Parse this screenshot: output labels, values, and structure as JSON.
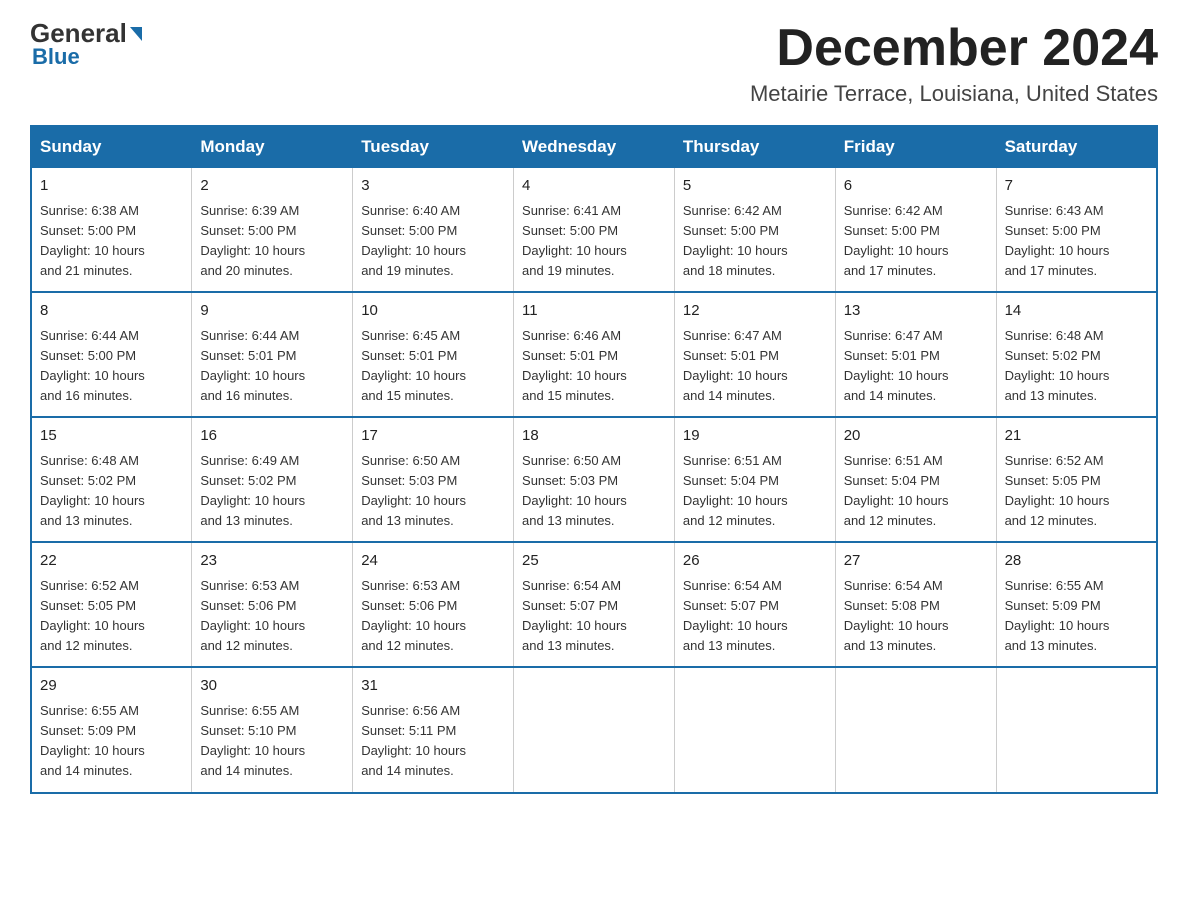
{
  "logo": {
    "general": "General",
    "blue": "Blue"
  },
  "header": {
    "month_title": "December 2024",
    "location": "Metairie Terrace, Louisiana, United States"
  },
  "weekdays": [
    "Sunday",
    "Monday",
    "Tuesday",
    "Wednesday",
    "Thursday",
    "Friday",
    "Saturday"
  ],
  "weeks": [
    [
      {
        "day": "1",
        "sunrise": "6:38 AM",
        "sunset": "5:00 PM",
        "daylight": "10 hours and 21 minutes."
      },
      {
        "day": "2",
        "sunrise": "6:39 AM",
        "sunset": "5:00 PM",
        "daylight": "10 hours and 20 minutes."
      },
      {
        "day": "3",
        "sunrise": "6:40 AM",
        "sunset": "5:00 PM",
        "daylight": "10 hours and 19 minutes."
      },
      {
        "day": "4",
        "sunrise": "6:41 AM",
        "sunset": "5:00 PM",
        "daylight": "10 hours and 19 minutes."
      },
      {
        "day": "5",
        "sunrise": "6:42 AM",
        "sunset": "5:00 PM",
        "daylight": "10 hours and 18 minutes."
      },
      {
        "day": "6",
        "sunrise": "6:42 AM",
        "sunset": "5:00 PM",
        "daylight": "10 hours and 17 minutes."
      },
      {
        "day": "7",
        "sunrise": "6:43 AM",
        "sunset": "5:00 PM",
        "daylight": "10 hours and 17 minutes."
      }
    ],
    [
      {
        "day": "8",
        "sunrise": "6:44 AM",
        "sunset": "5:00 PM",
        "daylight": "10 hours and 16 minutes."
      },
      {
        "day": "9",
        "sunrise": "6:44 AM",
        "sunset": "5:01 PM",
        "daylight": "10 hours and 16 minutes."
      },
      {
        "day": "10",
        "sunrise": "6:45 AM",
        "sunset": "5:01 PM",
        "daylight": "10 hours and 15 minutes."
      },
      {
        "day": "11",
        "sunrise": "6:46 AM",
        "sunset": "5:01 PM",
        "daylight": "10 hours and 15 minutes."
      },
      {
        "day": "12",
        "sunrise": "6:47 AM",
        "sunset": "5:01 PM",
        "daylight": "10 hours and 14 minutes."
      },
      {
        "day": "13",
        "sunrise": "6:47 AM",
        "sunset": "5:01 PM",
        "daylight": "10 hours and 14 minutes."
      },
      {
        "day": "14",
        "sunrise": "6:48 AM",
        "sunset": "5:02 PM",
        "daylight": "10 hours and 13 minutes."
      }
    ],
    [
      {
        "day": "15",
        "sunrise": "6:48 AM",
        "sunset": "5:02 PM",
        "daylight": "10 hours and 13 minutes."
      },
      {
        "day": "16",
        "sunrise": "6:49 AM",
        "sunset": "5:02 PM",
        "daylight": "10 hours and 13 minutes."
      },
      {
        "day": "17",
        "sunrise": "6:50 AM",
        "sunset": "5:03 PM",
        "daylight": "10 hours and 13 minutes."
      },
      {
        "day": "18",
        "sunrise": "6:50 AM",
        "sunset": "5:03 PM",
        "daylight": "10 hours and 13 minutes."
      },
      {
        "day": "19",
        "sunrise": "6:51 AM",
        "sunset": "5:04 PM",
        "daylight": "10 hours and 12 minutes."
      },
      {
        "day": "20",
        "sunrise": "6:51 AM",
        "sunset": "5:04 PM",
        "daylight": "10 hours and 12 minutes."
      },
      {
        "day": "21",
        "sunrise": "6:52 AM",
        "sunset": "5:05 PM",
        "daylight": "10 hours and 12 minutes."
      }
    ],
    [
      {
        "day": "22",
        "sunrise": "6:52 AM",
        "sunset": "5:05 PM",
        "daylight": "10 hours and 12 minutes."
      },
      {
        "day": "23",
        "sunrise": "6:53 AM",
        "sunset": "5:06 PM",
        "daylight": "10 hours and 12 minutes."
      },
      {
        "day": "24",
        "sunrise": "6:53 AM",
        "sunset": "5:06 PM",
        "daylight": "10 hours and 12 minutes."
      },
      {
        "day": "25",
        "sunrise": "6:54 AM",
        "sunset": "5:07 PM",
        "daylight": "10 hours and 13 minutes."
      },
      {
        "day": "26",
        "sunrise": "6:54 AM",
        "sunset": "5:07 PM",
        "daylight": "10 hours and 13 minutes."
      },
      {
        "day": "27",
        "sunrise": "6:54 AM",
        "sunset": "5:08 PM",
        "daylight": "10 hours and 13 minutes."
      },
      {
        "day": "28",
        "sunrise": "6:55 AM",
        "sunset": "5:09 PM",
        "daylight": "10 hours and 13 minutes."
      }
    ],
    [
      {
        "day": "29",
        "sunrise": "6:55 AM",
        "sunset": "5:09 PM",
        "daylight": "10 hours and 14 minutes."
      },
      {
        "day": "30",
        "sunrise": "6:55 AM",
        "sunset": "5:10 PM",
        "daylight": "10 hours and 14 minutes."
      },
      {
        "day": "31",
        "sunrise": "6:56 AM",
        "sunset": "5:11 PM",
        "daylight": "10 hours and 14 minutes."
      },
      null,
      null,
      null,
      null
    ]
  ],
  "labels": {
    "sunrise": "Sunrise: ",
    "sunset": "Sunset: ",
    "daylight": "Daylight: "
  }
}
